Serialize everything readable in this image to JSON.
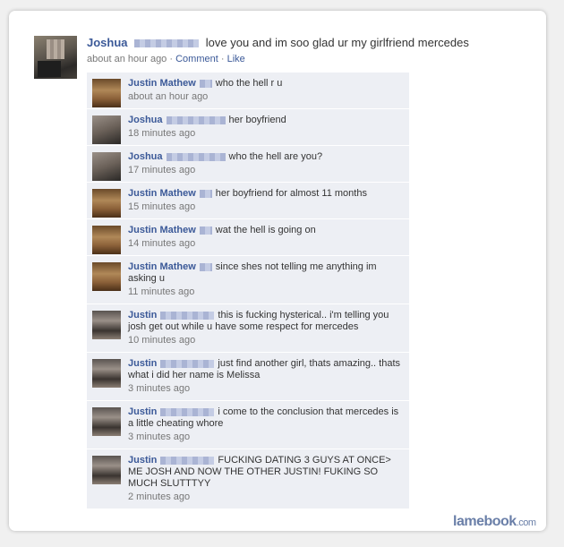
{
  "post": {
    "author": "Joshua",
    "text": "love you and im soo glad ur my girlfriend mercedes",
    "time": "about an hour ago",
    "separator": "·",
    "comment_link": "Comment",
    "like_link": "Like"
  },
  "comments": [
    {
      "author": "Justin Mathew",
      "avatar": "av-jm",
      "text": "who the hell r u",
      "time": "about an hour ago"
    },
    {
      "author": "Joshua",
      "avatar": "av-jo",
      "text": "her boyfriend",
      "time": "18 minutes ago"
    },
    {
      "author": "Joshua",
      "avatar": "av-jo",
      "text": "who the hell are you?",
      "time": "17 minutes ago"
    },
    {
      "author": "Justin Mathew",
      "avatar": "av-jm",
      "text": "her boyfriend for almost 11 months",
      "time": "15 minutes ago"
    },
    {
      "author": "Justin Mathew",
      "avatar": "av-jm",
      "text": "wat the hell is going on",
      "time": "14 minutes ago"
    },
    {
      "author": "Justin Mathew",
      "avatar": "av-jm",
      "text": "since shes not telling me anything im asking u",
      "time": "11 minutes ago"
    },
    {
      "author": "Justin",
      "avatar": "av-ju",
      "text": "this is fucking hysterical.. i'm telling you josh get out while u have some respect for mercedes",
      "time": "10 minutes ago"
    },
    {
      "author": "Justin",
      "avatar": "av-ju",
      "text": "just find another girl, thats amazing.. thats what i did her name is Melissa",
      "time": "3 minutes ago"
    },
    {
      "author": "Justin",
      "avatar": "av-ju",
      "text": "i come to the conclusion that mercedes is a little cheating whore",
      "time": "3 minutes ago"
    },
    {
      "author": "Justin",
      "avatar": "av-ju",
      "text": "FUCKING DATING 3 GUYS AT ONCE> ME JOSH AND NOW THE OTHER JUSTIN! FUKING SO MUCH SLUTTTYY",
      "time": "2 minutes ago"
    }
  ],
  "brand": {
    "name": "lamebook",
    "tld": ".com"
  }
}
